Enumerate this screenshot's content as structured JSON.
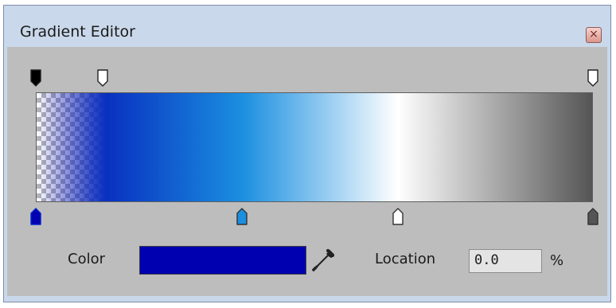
{
  "window": {
    "title": "Gradient Editor",
    "close_glyph": "×",
    "close_icon": "close-icon"
  },
  "gradient": {
    "opacity_stops": [
      {
        "location_pct": 0,
        "opacity_pct": 0,
        "color": "#000000"
      },
      {
        "location_pct": 12,
        "opacity_pct": 100,
        "color": "#ffffff"
      },
      {
        "location_pct": 100,
        "opacity_pct": 100,
        "color": "#ffffff"
      }
    ],
    "color_stops": [
      {
        "location_pct": 0,
        "color": "#0000b0",
        "selected": true
      },
      {
        "location_pct": 37,
        "color": "#1a8fe0",
        "selected": false
      },
      {
        "location_pct": 65,
        "color": "#ffffff",
        "selected": false
      },
      {
        "location_pct": 100,
        "color": "#555555",
        "selected": false
      }
    ]
  },
  "controls": {
    "color_label": "Color",
    "color_value": "#0000b0",
    "eyedropper_icon": "eyedropper-icon",
    "location_label": "Location",
    "location_value": "0.0",
    "percent_label": "%"
  }
}
